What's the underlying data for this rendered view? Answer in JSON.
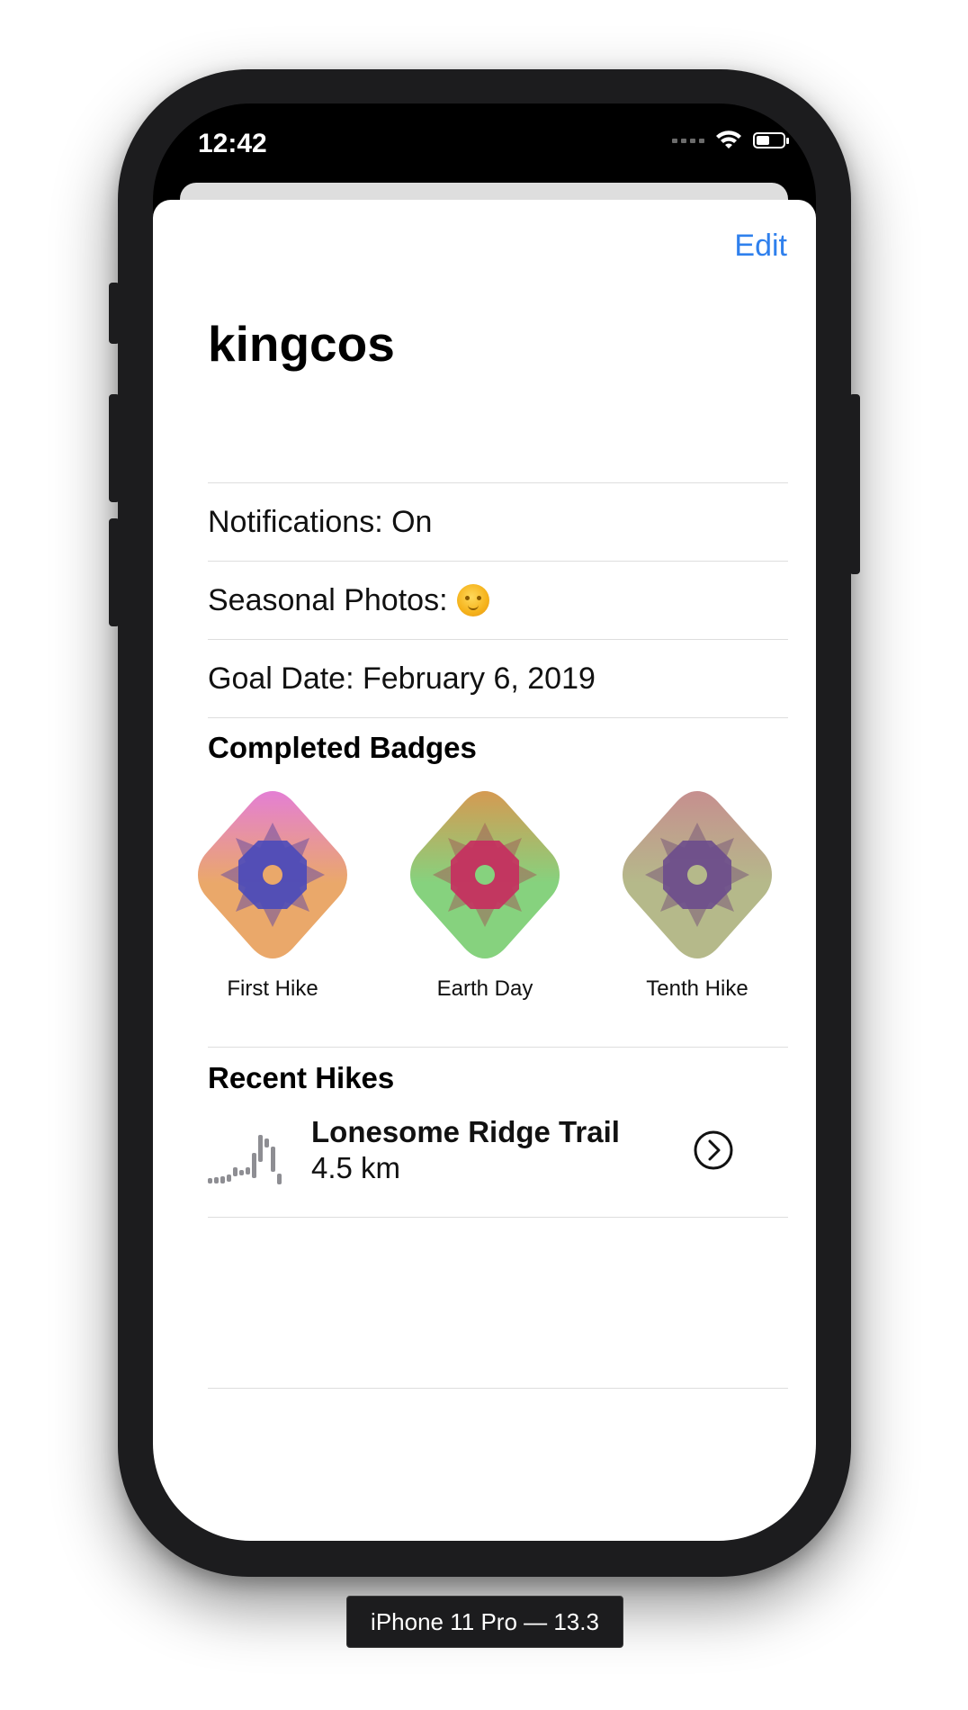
{
  "status_bar": {
    "time": "12:42",
    "wifi_icon": "wifi-icon",
    "battery_icon": "battery-icon"
  },
  "nav": {
    "edit_label": "Edit"
  },
  "profile": {
    "username": "kingcos",
    "notifications": "Notifications: On",
    "seasonal_photos": "Seasonal Photos:",
    "seasonal_icon": "sun-face-emoji",
    "goal_date": "Goal Date: February 6, 2019"
  },
  "badges": {
    "title": "Completed Badges",
    "items": [
      {
        "label": "First Hike",
        "colors": [
          "#e47fd4",
          "#eaa86a"
        ],
        "center_color": "#4a4aba"
      },
      {
        "label": "Earth Day",
        "colors": [
          "#d59a52",
          "#86d27e"
        ],
        "center_color": "#c72c5f"
      },
      {
        "label": "Tenth Hike",
        "colors": [
          "#c68f8f",
          "#b5b98a"
        ],
        "center_color": "#6c4c8c"
      }
    ]
  },
  "recent_hikes": {
    "title": "Recent Hikes",
    "items": [
      {
        "name": "Lonesome Ridge Trail",
        "distance": "4.5 km",
        "chevron_icon": "chevron-right-circle-icon"
      }
    ]
  },
  "device_label": "iPhone 11 Pro — 13.3"
}
